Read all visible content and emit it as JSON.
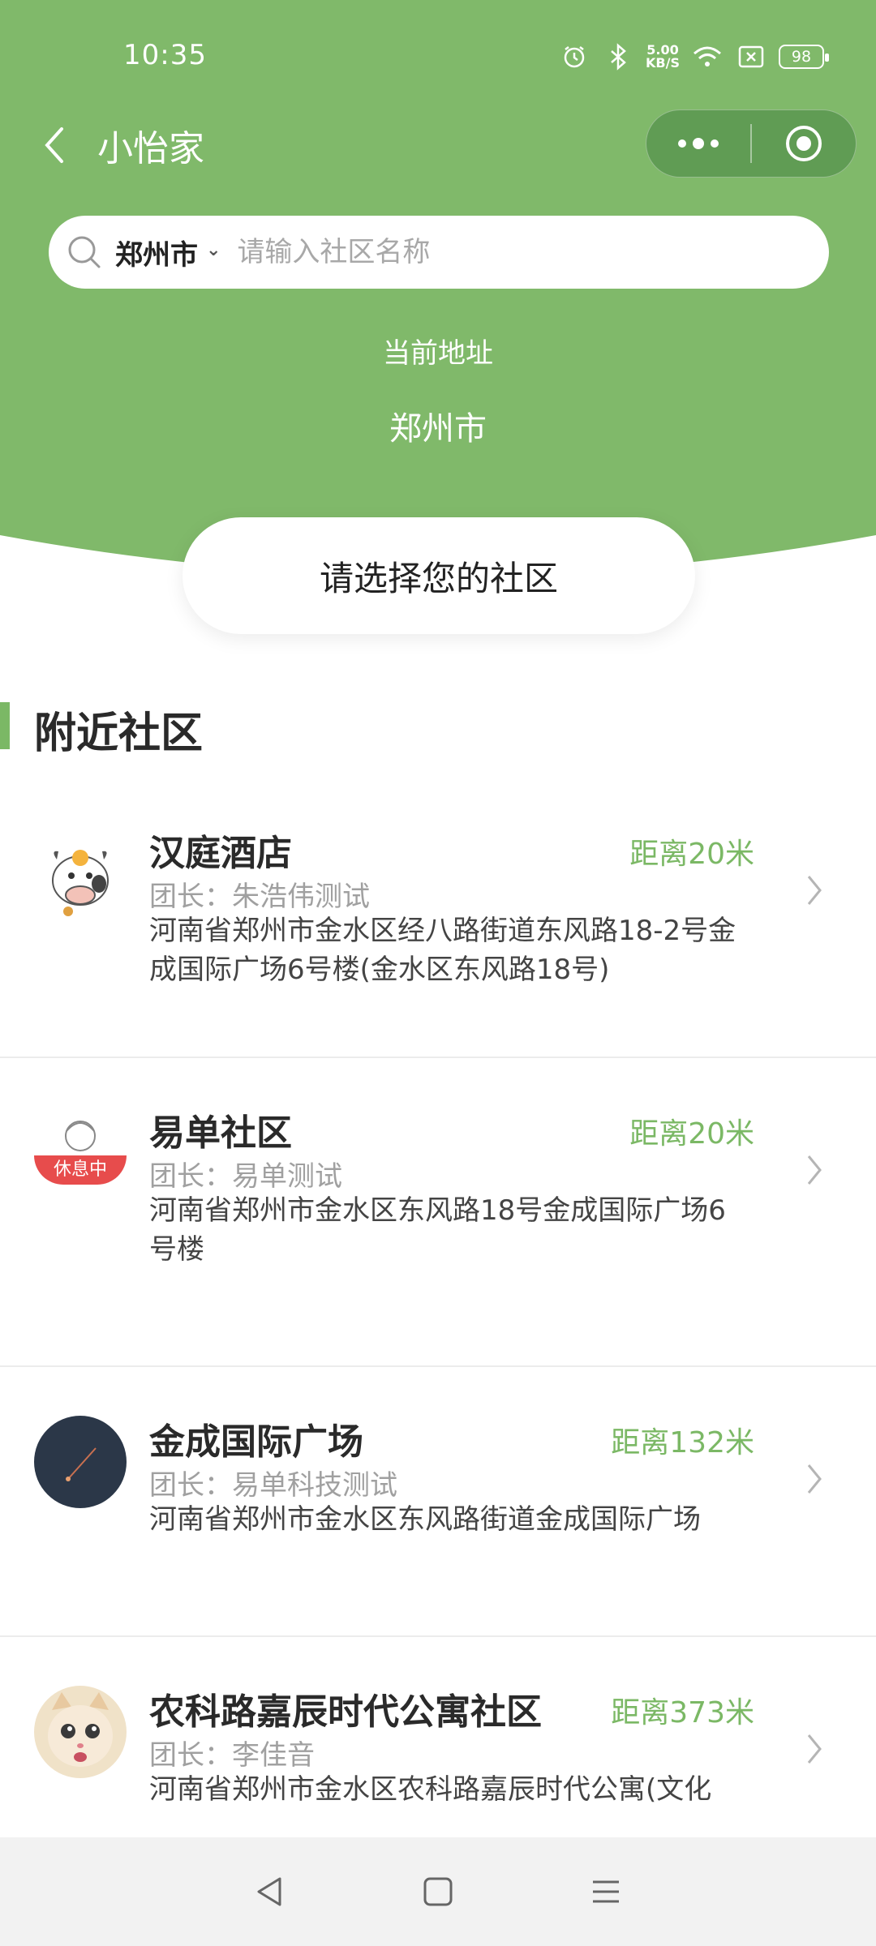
{
  "colors": {
    "brand_green": "#7bb865",
    "header_green": "#80b96a"
  },
  "status_bar": {
    "time": "10:35",
    "speed_value": "5.00",
    "speed_unit": "KB/S",
    "battery": "98"
  },
  "nav": {
    "title": "小怡家"
  },
  "search": {
    "city": "郑州市",
    "placeholder": "请输入社区名称"
  },
  "location": {
    "label": "当前地址",
    "city": "郑州市"
  },
  "select_card": {
    "label": "请选择您的社区"
  },
  "section": {
    "title": "附近社区"
  },
  "communities": [
    {
      "name": "汉庭酒店",
      "distance": "距离20米",
      "leader": "团长：朱浩伟测试",
      "address": "河南省郑州市金水区经八路街道东风路18-2号金成国际广场6号楼(金水区东风路18号)",
      "avatar_icon": "cow-avatar"
    },
    {
      "name": "易单社区",
      "distance": "距离20米",
      "leader": "团长：易单测试",
      "address": "河南省郑州市金水区东风路18号金成国际广场6号楼",
      "avatar_icon": "sketch-avatar",
      "badge": "休息中"
    },
    {
      "name": "金成国际广场",
      "distance": "距离132米",
      "leader": "团长：易单科技测试",
      "address": "河南省郑州市金水区东风路街道金成国际广场",
      "avatar_icon": "dark-avatar"
    },
    {
      "name": "农科路嘉辰时代公寓社区",
      "distance": "距离373米",
      "leader": "团长：李佳音",
      "address": "河南省郑州市金水区农科路嘉辰时代公寓(文化",
      "avatar_icon": "cat-avatar"
    }
  ]
}
